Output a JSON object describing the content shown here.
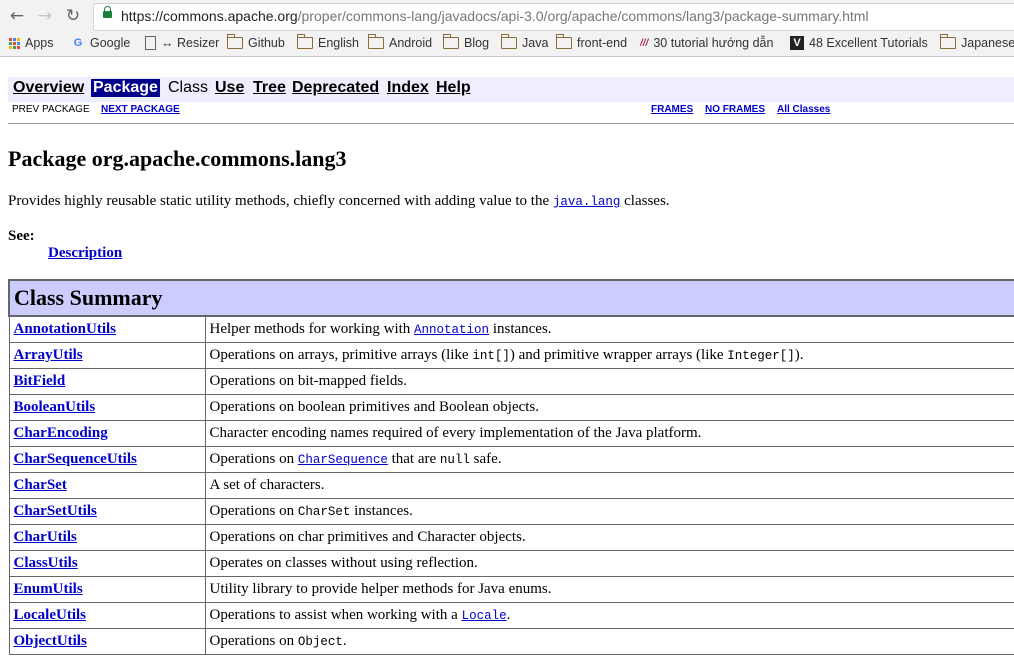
{
  "browser": {
    "url_scheme_host": "https://commons.apache.org",
    "url_path": "/proper/commons-lang/javadocs/api-3.0/org/apache/commons/lang3/package-summary.html",
    "bookmarks": [
      "Apps",
      "Google",
      "↔ Resizer",
      "Github",
      "English",
      "Android",
      "Blog",
      "Java",
      "front-end",
      "30 tutorial hướng dẫn",
      "48 Excellent Tutorials",
      "Japanese"
    ]
  },
  "nav": {
    "items": [
      "Overview",
      "Package",
      "Class",
      "Use",
      "Tree",
      "Deprecated",
      "Index",
      "Help"
    ],
    "prev_package": "PREV PACKAGE",
    "next_package": "NEXT PACKAGE",
    "frames": "FRAMES",
    "no_frames": "NO FRAMES",
    "all_classes": "All Classes"
  },
  "page": {
    "title": "Package org.apache.commons.lang3",
    "description_pre": "Provides highly reusable static utility methods, chiefly concerned with adding value to the ",
    "description_link": "java.lang",
    "description_post": " classes.",
    "see_label": "See:",
    "see_link": "Description"
  },
  "summary": {
    "heading": "Class Summary",
    "rows": [
      {
        "name": "AnnotationUtils",
        "pre": "Helper methods for working with ",
        "code": "Annotation",
        "code_link": true,
        "post": " instances."
      },
      {
        "name": "ArrayUtils",
        "pre": "Operations on arrays, primitive arrays (like ",
        "code": "int[]",
        "code_link": false,
        "post": ") and primitive wrapper arrays (like ",
        "code2": "Integer[]",
        "post2": ")."
      },
      {
        "name": "BitField",
        "pre": "Operations on bit-mapped fields."
      },
      {
        "name": "BooleanUtils",
        "pre": "Operations on boolean primitives and Boolean objects."
      },
      {
        "name": "CharEncoding",
        "pre": "Character encoding names required of every implementation of the Java platform."
      },
      {
        "name": "CharSequenceUtils",
        "pre": "Operations on ",
        "code": "CharSequence",
        "code_link": true,
        "post": " that are ",
        "code2": "null",
        "post2": " safe."
      },
      {
        "name": "CharSet",
        "pre": "A set of characters."
      },
      {
        "name": "CharSetUtils",
        "pre": "Operations on ",
        "code": "CharSet",
        "code_link": false,
        "post": " instances."
      },
      {
        "name": "CharUtils",
        "pre": "Operations on char primitives and Character objects."
      },
      {
        "name": "ClassUtils",
        "pre": "Operates on classes without using reflection."
      },
      {
        "name": "EnumUtils",
        "pre": "Utility library to provide helper methods for Java enums."
      },
      {
        "name": "LocaleUtils",
        "pre": "Operations to assist when working with a ",
        "code": "Locale",
        "code_link": true,
        "post": "."
      },
      {
        "name": "ObjectUtils",
        "pre": "Operations on ",
        "code": "Object",
        "code_link": false,
        "post": "."
      }
    ]
  }
}
